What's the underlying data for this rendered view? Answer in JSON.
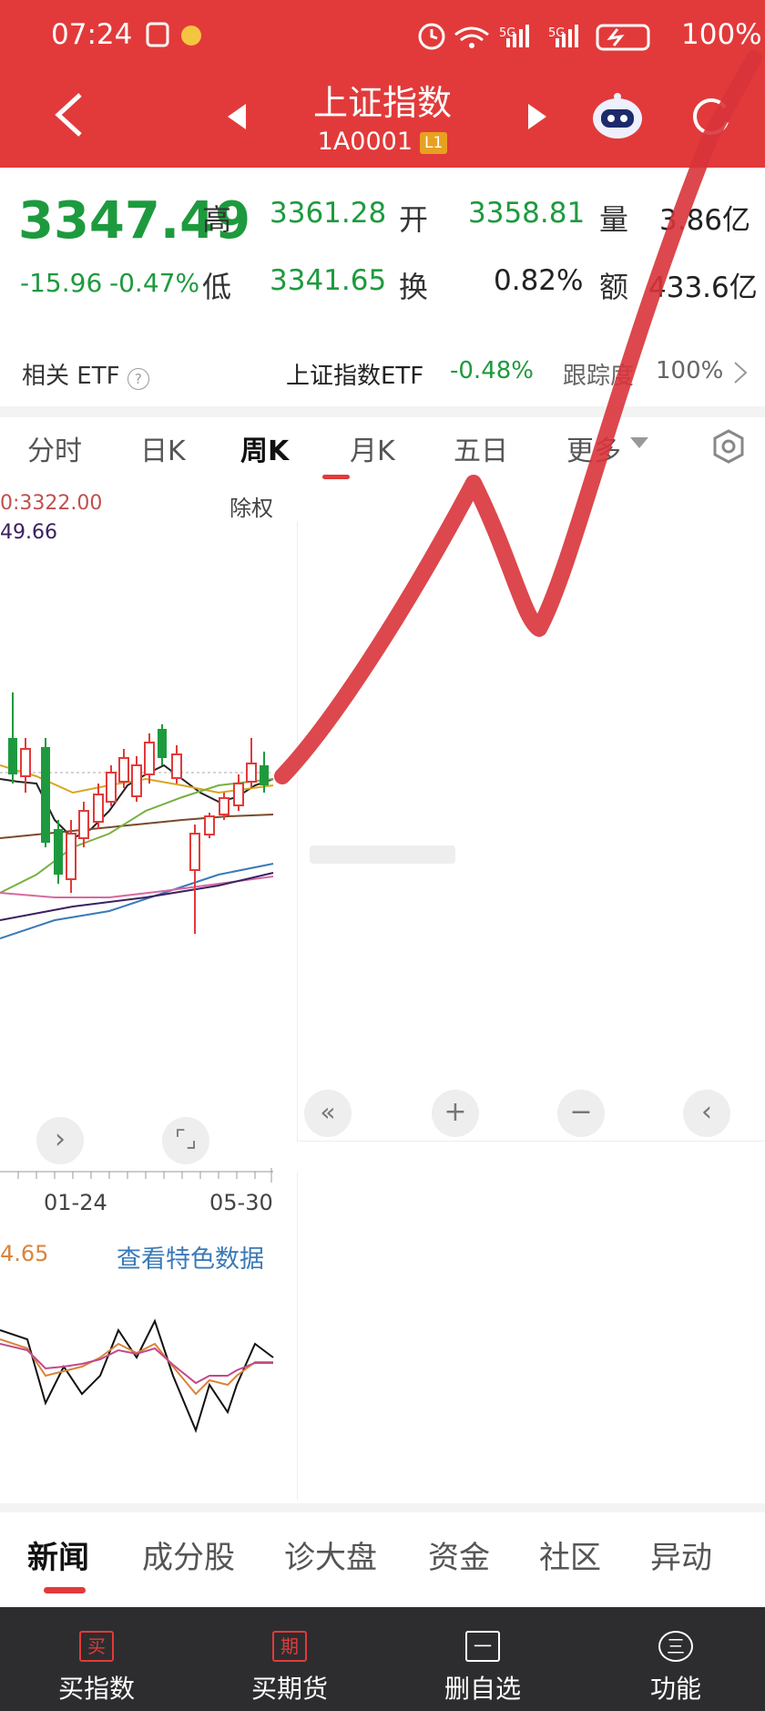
{
  "status": {
    "time": "07:24",
    "battery": "100%"
  },
  "header": {
    "title": "上证指数",
    "code": "1A0001",
    "level_badge": "L1"
  },
  "quote": {
    "price": "3347.49",
    "change": "-15.96",
    "change_pct": "-0.47%",
    "high_label": "高",
    "high": "3361.28",
    "open_label": "开",
    "open": "3358.81",
    "volume_label": "量",
    "volume": "3.86亿",
    "low_label": "低",
    "low": "3341.65",
    "turnover_label": "换",
    "turnover": "0.82%",
    "amount_label": "额",
    "amount": "433.6亿"
  },
  "etf": {
    "label": "相关 ETF",
    "name": "上证指数ETF",
    "change": "-0.48%",
    "track_label": "跟踪度",
    "track_value": "100%"
  },
  "chart_tabs": [
    "分时",
    "日K",
    "周K",
    "月K",
    "五日",
    "更多"
  ],
  "active_chart_tab": "周K",
  "chart": {
    "ma_line1": "0:3322.00",
    "ma_line2": "49.66",
    "adjust_label": "除权",
    "date_left": "01-24",
    "date_right": "05-30",
    "indicator_value": "4.65",
    "special_data_link": "查看特色数据"
  },
  "news_tabs": [
    "新闻",
    "成分股",
    "诊大盘",
    "资金",
    "社区",
    "异动"
  ],
  "bottom_nav": [
    {
      "label": "买指数",
      "icon": "买"
    },
    {
      "label": "买期货",
      "icon": "期"
    },
    {
      "label": "删自选",
      "icon": "一"
    },
    {
      "label": "功能",
      "icon": "三"
    }
  ],
  "colors": {
    "header": "#e23a3a",
    "down": "#1e9a3e",
    "up": "#e23a3a",
    "nav": "#2d2d2f"
  }
}
